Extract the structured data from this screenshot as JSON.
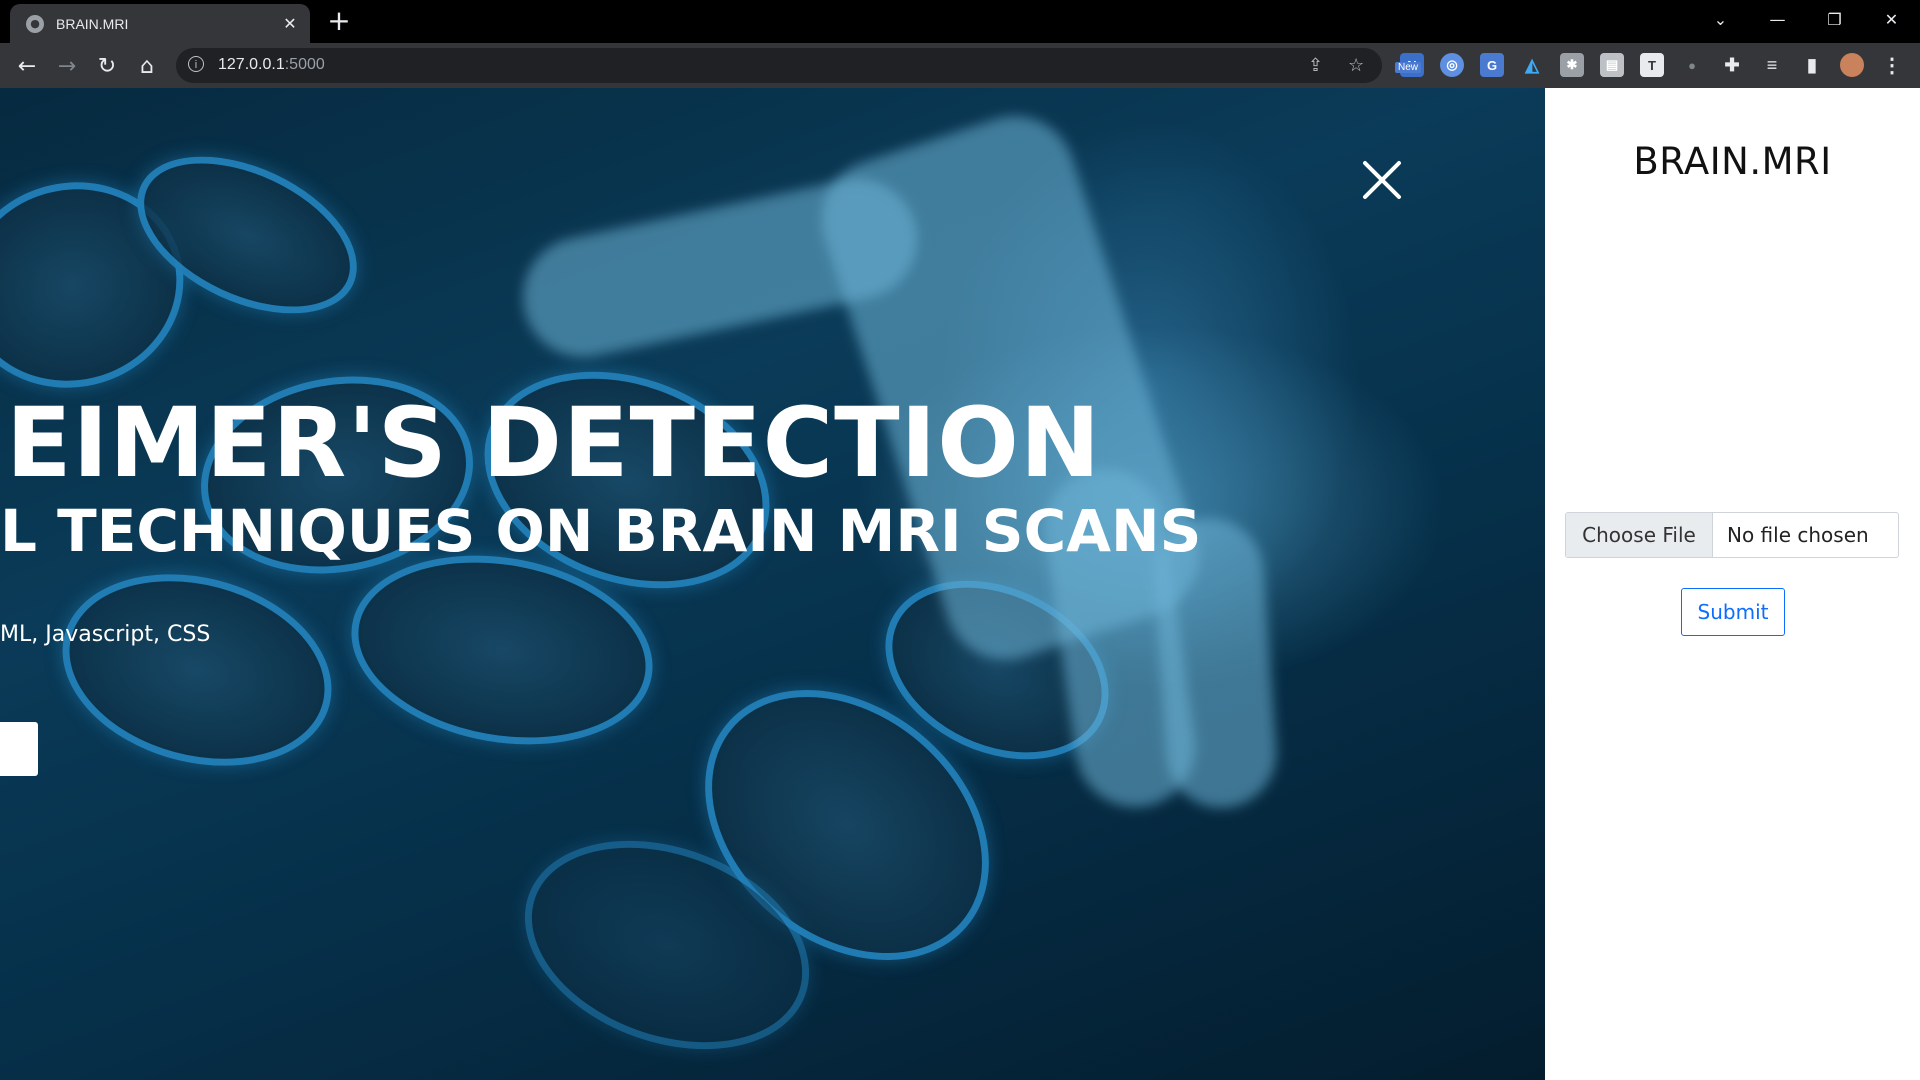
{
  "browser": {
    "tab_title": "BRAIN.MRI",
    "tab_close_icon": "close-icon",
    "new_tab_label": "+",
    "url_host": "127.0.0.1",
    "url_port": ":5000",
    "extension_badge": "New",
    "window_controls": [
      "chevron-down-icon",
      "minimize-icon",
      "restore-icon",
      "close-icon"
    ]
  },
  "hero": {
    "title": "EIMER'S DETECTION",
    "subtitle": "L TECHNIQUES ON BRAIN MRI SCANS",
    "tech": "ML, Javascript, CSS",
    "overlay_color": "#0a3b58"
  },
  "panel": {
    "brand": "BRAIN.MRI",
    "file_button_label": "Choose File",
    "file_status": "No file chosen",
    "submit_label": "Submit",
    "accent_color": "#0d6efd"
  }
}
